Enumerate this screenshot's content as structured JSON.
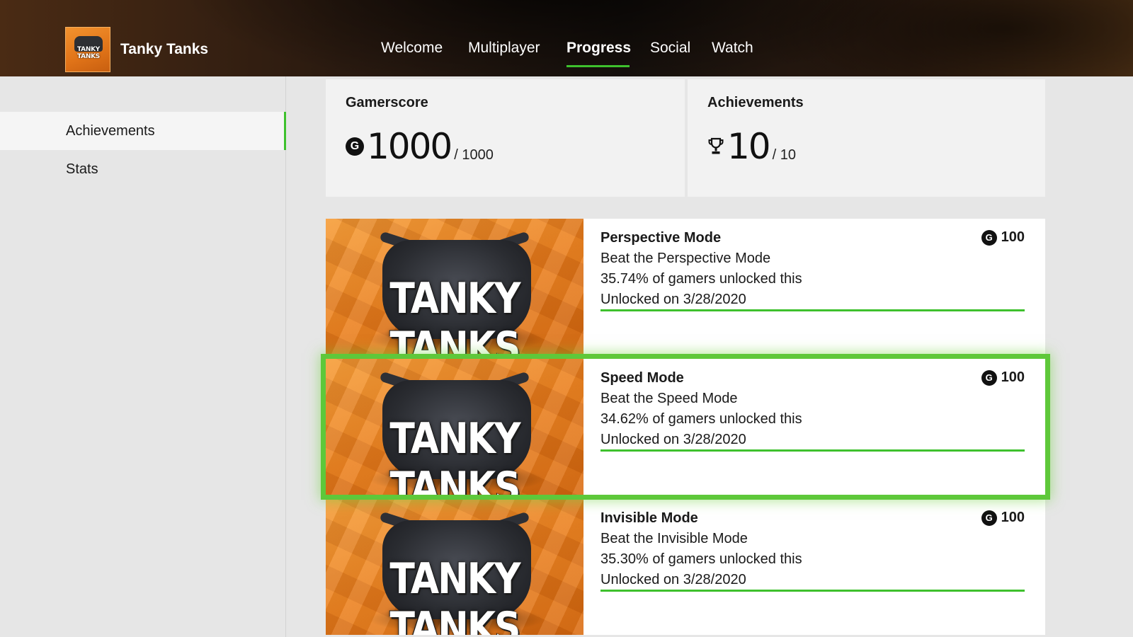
{
  "header": {
    "game_title": "Tanky Tanks",
    "logo_text": "TANKY TANKS",
    "tabs": [
      {
        "label": "Welcome",
        "active": false
      },
      {
        "label": "Multiplayer",
        "active": false
      },
      {
        "label": "Progress",
        "active": true
      },
      {
        "label": "Social",
        "active": false
      },
      {
        "label": "Watch",
        "active": false
      }
    ]
  },
  "sidebar": {
    "items": [
      {
        "label": "Achievements",
        "active": true
      },
      {
        "label": "Stats",
        "active": false
      }
    ]
  },
  "summary": {
    "gamerscore": {
      "title": "Gamerscore",
      "icon": "G",
      "value": "1000",
      "max": "/ 1000"
    },
    "achievements": {
      "title": "Achievements",
      "value": "10",
      "max": "/ 10"
    }
  },
  "achievements": [
    {
      "art_text": "TANKY TANKS",
      "name": "Perspective Mode",
      "description": "Beat the Perspective Mode",
      "percent": "35.74% of gamers unlocked this",
      "unlocked": "Unlocked on 3/28/2020",
      "score_icon": "G",
      "score": "100",
      "progress": 1.0,
      "focused": false
    },
    {
      "art_text": "TANKY TANKS",
      "name": "Speed Mode",
      "description": "Beat the Speed Mode",
      "percent": "34.62% of gamers unlocked this",
      "unlocked": "Unlocked on 3/28/2020",
      "score_icon": "G",
      "score": "100",
      "progress": 1.0,
      "focused": true
    },
    {
      "art_text": "TANKY TANKS",
      "name": "Invisible Mode",
      "description": "Beat the Invisible Mode",
      "percent": "35.30% of gamers unlocked this",
      "unlocked": "Unlocked on 3/28/2020",
      "score_icon": "G",
      "score": "100",
      "progress": 1.0,
      "focused": false
    }
  ],
  "colors": {
    "accent": "#3ec12d",
    "focus": "#5ec83a",
    "art_orange": "#ea7d1c"
  }
}
